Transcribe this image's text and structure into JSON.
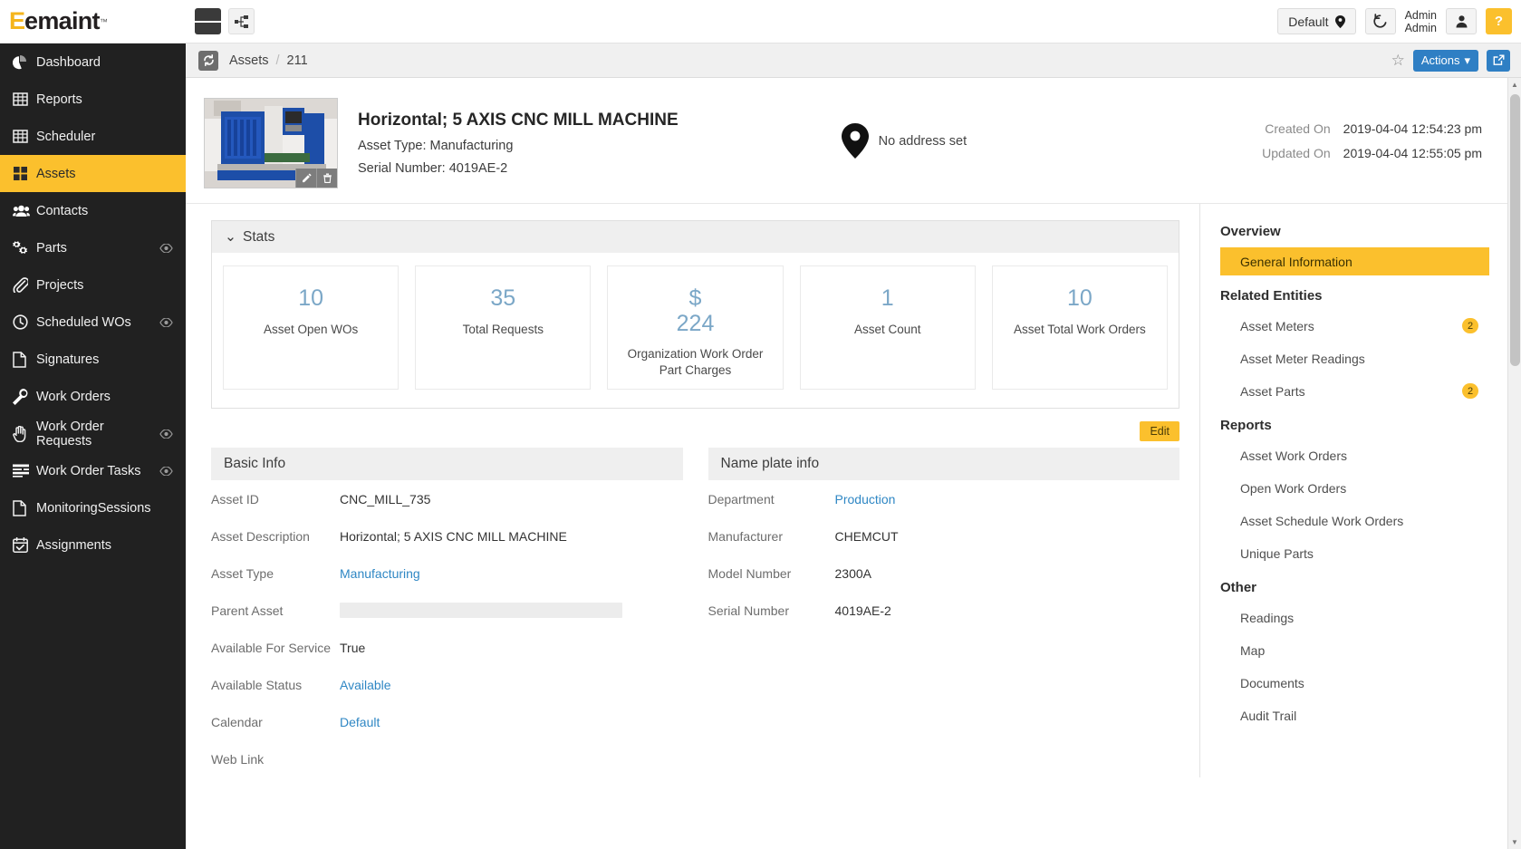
{
  "topbar": {
    "logo_mark": "E",
    "logo_text": "emaint",
    "logo_tm": "™",
    "menu_icon": "hamburger-icon",
    "tree_icon": "sitemap-icon",
    "site_selector_label": "Default",
    "site_selector_icon": "map-pin-icon",
    "history_icon": "history-revert-icon",
    "user_line1": "Admin",
    "user_line2": "Admin",
    "user_icon": "user-avatar-icon",
    "help_label": "?"
  },
  "sidebar": {
    "items": [
      {
        "label": "Dashboard",
        "icon": "pie-chart-icon",
        "active": false,
        "eye": false
      },
      {
        "label": "Reports",
        "icon": "table-grid-icon",
        "active": false,
        "eye": false
      },
      {
        "label": "Scheduler",
        "icon": "table-grid-icon",
        "active": false,
        "eye": false
      },
      {
        "label": "Assets",
        "icon": "squares-icon",
        "active": true,
        "eye": false
      },
      {
        "label": "Contacts",
        "icon": "people-icon",
        "active": false,
        "eye": false
      },
      {
        "label": "Parts",
        "icon": "gears-icon",
        "active": false,
        "eye": true
      },
      {
        "label": "Projects",
        "icon": "paperclip-icon",
        "active": false,
        "eye": false
      },
      {
        "label": "Scheduled WOs",
        "icon": "clock-icon",
        "active": false,
        "eye": true
      },
      {
        "label": "Signatures",
        "icon": "document-icon",
        "active": false,
        "eye": false
      },
      {
        "label": "Work Orders",
        "icon": "wrench-icon",
        "active": false,
        "eye": false
      },
      {
        "label": "Work Order Requests",
        "icon": "hand-icon",
        "active": false,
        "eye": true
      },
      {
        "label": "Work Order Tasks",
        "icon": "list-lines-icon",
        "active": false,
        "eye": true
      },
      {
        "label": "MonitoringSessions",
        "icon": "document-icon",
        "active": false,
        "eye": false
      },
      {
        "label": "Assignments",
        "icon": "calendar-check-icon",
        "active": false,
        "eye": false
      }
    ]
  },
  "breadcrumb": {
    "refresh_icon": "refresh-icon",
    "parent": "Assets",
    "separator": "/",
    "current": "211",
    "star_icon": "star-outline-icon",
    "actions_label": "Actions",
    "actions_caret": "▾",
    "share_icon": "external-share-icon"
  },
  "asset_header": {
    "thumbnail_alt": "cnc-mill-photo",
    "edit_icon": "pencil-icon",
    "delete_icon": "trash-icon",
    "title": "Horizontal; 5 AXIS CNC MILL MACHINE",
    "asset_type_line": "Asset Type: Manufacturing",
    "serial_number_line": "Serial Number:  4019AE-2",
    "location_icon": "map-pin-icon",
    "address_text": "No address set",
    "created_on_label": "Created On",
    "created_on_value": "2019-04-04 12:54:23 pm",
    "updated_on_label": "Updated On",
    "updated_on_value": "2019-04-04 12:55:05 pm"
  },
  "stats": {
    "caret": "⌄",
    "title": "Stats",
    "cards": [
      {
        "value": "10",
        "label": "Asset Open WOs"
      },
      {
        "value": "35",
        "label": "Total Requests"
      },
      {
        "value": "$\n224",
        "value_top": "$",
        "value_bottom": "224",
        "label": "Organization Work Order Part Charges"
      },
      {
        "value": "1",
        "label": "Asset Count"
      },
      {
        "value": "10",
        "label": "Asset Total Work Orders"
      }
    ]
  },
  "edit_button_label": "Edit",
  "basic_info": {
    "title": "Basic Info",
    "rows": [
      {
        "label": "Asset ID",
        "value": "CNC_MILL_735",
        "link": false
      },
      {
        "label": "Asset Description",
        "value": "Horizontal; 5 AXIS CNC MILL MACHINE",
        "link": false
      },
      {
        "label": "Asset Type",
        "value": "Manufacturing",
        "link": true
      },
      {
        "label": "Parent Asset",
        "value": "",
        "link": false,
        "empty_input": true
      },
      {
        "label": "Available For Service",
        "value": "True",
        "link": false
      },
      {
        "label": "Available Status",
        "value": "Available",
        "link": true
      },
      {
        "label": "Calendar",
        "value": "Default",
        "link": true
      },
      {
        "label": "Web Link",
        "value": "",
        "link": false
      }
    ]
  },
  "name_plate_info": {
    "title": "Name plate info",
    "rows": [
      {
        "label": "Department",
        "value": "Production",
        "link": true
      },
      {
        "label": "Manufacturer",
        "value": "CHEMCUT",
        "link": false
      },
      {
        "label": "Model Number",
        "value": "2300A",
        "link": false
      },
      {
        "label": "Serial Number",
        "value": "4019AE-2",
        "link": false
      }
    ]
  },
  "right_nav": {
    "groups": [
      {
        "title": "Overview",
        "items": [
          {
            "label": "General Information",
            "active": true,
            "badge": ""
          }
        ]
      },
      {
        "title": "Related Entities",
        "items": [
          {
            "label": "Asset Meters",
            "active": false,
            "badge": "2"
          },
          {
            "label": "Asset Meter Readings",
            "active": false,
            "badge": ""
          },
          {
            "label": "Asset Parts",
            "active": false,
            "badge": "2"
          }
        ]
      },
      {
        "title": "Reports",
        "items": [
          {
            "label": "Asset Work Orders",
            "active": false,
            "badge": ""
          },
          {
            "label": "Open Work Orders",
            "active": false,
            "badge": ""
          },
          {
            "label": "Asset Schedule Work Orders",
            "active": false,
            "badge": ""
          },
          {
            "label": "Unique Parts",
            "active": false,
            "badge": ""
          }
        ]
      },
      {
        "title": "Other",
        "items": [
          {
            "label": "Readings",
            "active": false,
            "badge": ""
          },
          {
            "label": "Map",
            "active": false,
            "badge": ""
          },
          {
            "label": "Documents",
            "active": false,
            "badge": ""
          },
          {
            "label": "Audit Trail",
            "active": false,
            "badge": ""
          }
        ]
      }
    ]
  },
  "scrollbar": {
    "up_arrow": "▲",
    "down_arrow": "▼"
  },
  "colors": {
    "accent": "#fbc02d",
    "sidebar_bg": "#212121",
    "link": "#2f87c4",
    "stat_number": "#7ba7c7",
    "action_blue": "#2f7fc4"
  }
}
